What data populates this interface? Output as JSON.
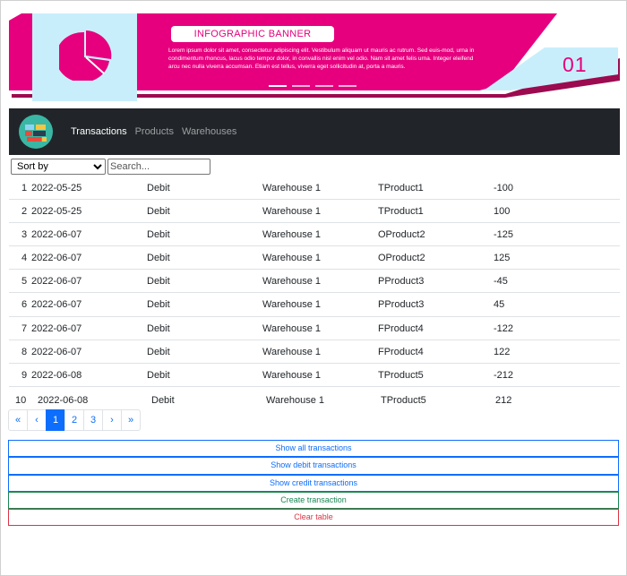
{
  "banner": {
    "title": "INFOGRAPHIC BANNER",
    "text": "Lorem ipsum dolor sit amet, consectetur adipiscing elit. Vestibulum aliquam ut mauris ac rutrum. Sed euis-mod, urna in condimentum rhoncus, lacus odio tempor dolor, in convallis nisl enim vel odio. Nam sit amet felis urna. Integer eleifend arcu nec nulla viverra accumsan. Etiam est tellus, viverra eget sollicitudin at, porta a mauris.",
    "number": "01",
    "slide_count": 4,
    "active_slide": 1,
    "colors": {
      "pink": "#e6007e",
      "light_blue": "#c9eefb",
      "dark_pink": "#9c0a4f"
    }
  },
  "navbar": {
    "logo": "warehouse-logo-icon",
    "links": [
      {
        "label": "Transactions",
        "active": true
      },
      {
        "label": "Products",
        "active": false
      },
      {
        "label": "Warehouses",
        "active": false
      }
    ]
  },
  "controls": {
    "sort_selected": "Sort by",
    "search_placeholder": "Search..."
  },
  "table": {
    "rows": [
      {
        "id": "1",
        "date": "2022-05-25",
        "type": "Debit",
        "warehouse": "Warehouse 1",
        "product": "TProduct1",
        "quantity": "-100"
      },
      {
        "id": "2",
        "date": "2022-05-25",
        "type": "Debit",
        "warehouse": "Warehouse 1",
        "product": "TProduct1",
        "quantity": "100"
      },
      {
        "id": "3",
        "date": "2022-06-07",
        "type": "Debit",
        "warehouse": "Warehouse 1",
        "product": "OProduct2",
        "quantity": "-125"
      },
      {
        "id": "4",
        "date": "2022-06-07",
        "type": "Debit",
        "warehouse": "Warehouse 1",
        "product": "OProduct2",
        "quantity": "125"
      },
      {
        "id": "5",
        "date": "2022-06-07",
        "type": "Debit",
        "warehouse": "Warehouse 1",
        "product": "PProduct3",
        "quantity": "-45"
      },
      {
        "id": "6",
        "date": "2022-06-07",
        "type": "Debit",
        "warehouse": "Warehouse 1",
        "product": "PProduct3",
        "quantity": "45"
      },
      {
        "id": "7",
        "date": "2022-06-07",
        "type": "Debit",
        "warehouse": "Warehouse 1",
        "product": "FProduct4",
        "quantity": "-122"
      },
      {
        "id": "8",
        "date": "2022-06-07",
        "type": "Debit",
        "warehouse": "Warehouse 1",
        "product": "FProduct4",
        "quantity": "122"
      },
      {
        "id": "9",
        "date": "2022-06-08",
        "type": "Debit",
        "warehouse": "Warehouse 1",
        "product": "TProduct5",
        "quantity": "-212"
      },
      {
        "id": "10",
        "date": "2022-06-08",
        "type": "Debit",
        "warehouse": "Warehouse 1",
        "product": "TProduct5",
        "quantity": "212"
      }
    ]
  },
  "pagination": {
    "first": "«",
    "prev": "‹",
    "pages": [
      "1",
      "2",
      "3"
    ],
    "current": "1",
    "next": "›",
    "last": "»"
  },
  "actions": {
    "show_all": "Show all transactions",
    "show_debit": "Show debit transactions",
    "show_credit": "Show credit transactions",
    "create": "Create transaction",
    "clear": "Clear table"
  }
}
